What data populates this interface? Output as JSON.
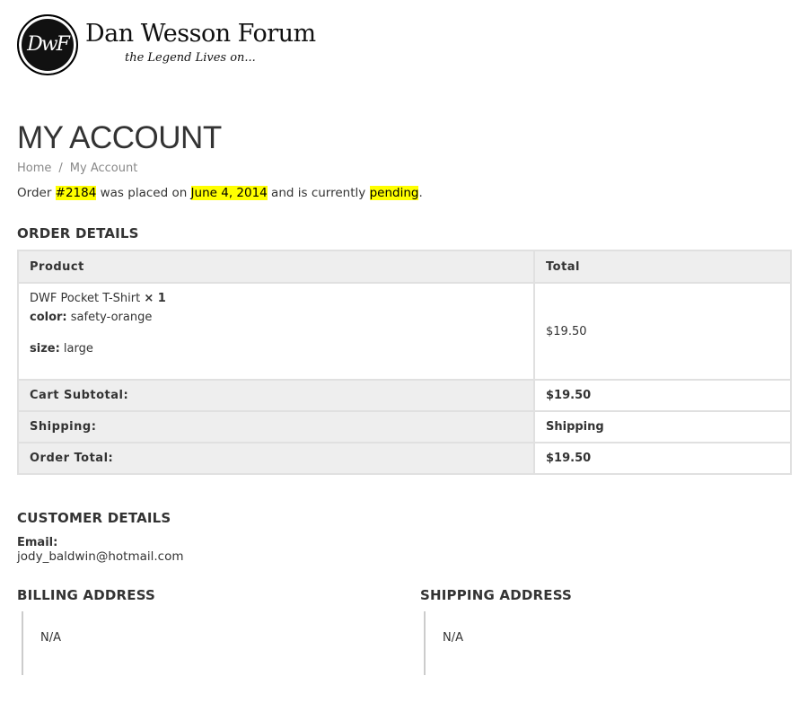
{
  "site": {
    "logo_text": "DwF",
    "name": "Dan Wesson Forum",
    "tagline": "the Legend Lives on..."
  },
  "page": {
    "title": "MY ACCOUNT",
    "breadcrumb": {
      "home": "Home",
      "separator": "/",
      "current": "My Account"
    }
  },
  "order_status": {
    "prefix": "Order ",
    "number": "#2184",
    "mid": " was placed on ",
    "date": "June 4, 2014",
    "mid2": " and is currently ",
    "status": "pending",
    "suffix": "."
  },
  "order_details": {
    "heading": "ORDER DETAILS",
    "columns": {
      "product": "Product",
      "total": "Total"
    },
    "item": {
      "name": "DWF Pocket T-Shirt",
      "qty": "× 1",
      "color_label": "color:",
      "color_value": " safety-orange",
      "size_label": "size:",
      "size_value": " large",
      "total": "$19.50"
    },
    "totals": [
      {
        "label": "Cart Subtotal:",
        "value": "$19.50"
      },
      {
        "label": "Shipping:",
        "value": "Shipping"
      },
      {
        "label": "Order Total:",
        "value": "$19.50"
      }
    ]
  },
  "customer_details": {
    "heading": "CUSTOMER DETAILS",
    "email_label": "Email:",
    "email": "jody_baldwin@hotmail.com"
  },
  "billing": {
    "heading": "BILLING ADDRESS",
    "value": "N/A"
  },
  "shipping": {
    "heading": "SHIPPING ADDRESS",
    "value": "N/A"
  },
  "colors": {
    "highlight": "#ffff00",
    "table_header_bg": "#eeeeee",
    "border": "#e0e0e0"
  }
}
